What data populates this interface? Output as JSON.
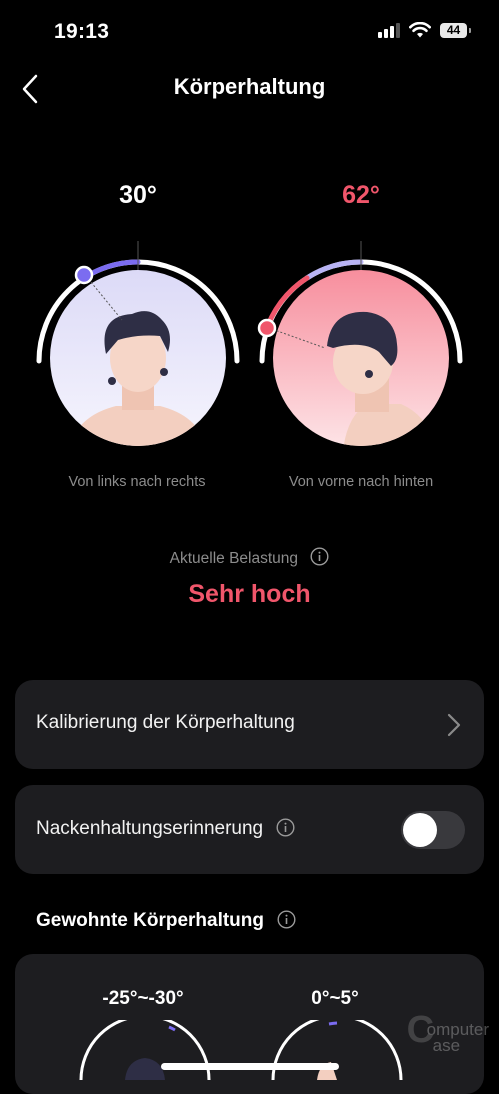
{
  "status_bar": {
    "time": "19:13",
    "battery": "44"
  },
  "header": {
    "title": "Körperhaltung"
  },
  "gauges": [
    {
      "angle": "30°",
      "label": "Von links nach rechts",
      "value_degrees": 30
    },
    {
      "angle": "62°",
      "label": "Von vorne nach hinten",
      "value_degrees": 62
    }
  ],
  "load": {
    "label": "Aktuelle Belastung",
    "value": "Sehr hoch"
  },
  "calibration": {
    "label": "Kalibrierung der Körperhaltung"
  },
  "neck_reminder": {
    "label": "Nackenhaltungserinnerung",
    "enabled": false
  },
  "habitual": {
    "title": "Gewohnte Körperhaltung",
    "ranges": [
      "-25°~-30°",
      "0°~5°"
    ]
  },
  "watermark": {
    "line1": "omputer",
    "line2": "ase"
  },
  "colors": {
    "accent_red": "#f0566b",
    "accent_purple": "#7b6cf0",
    "card_bg": "#1d1d20"
  }
}
